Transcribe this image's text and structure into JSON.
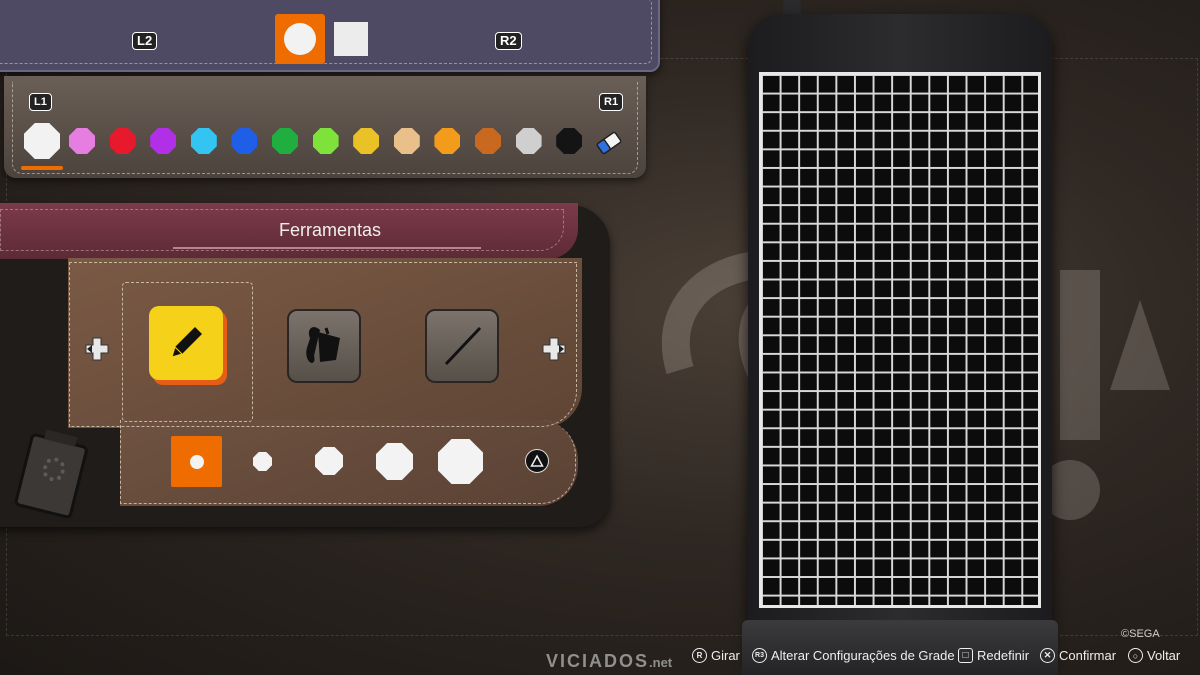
{
  "shape_bar": {
    "left_trigger": "L2",
    "right_trigger": "R2",
    "shapes": [
      {
        "name": "circle",
        "selected": true
      },
      {
        "name": "square",
        "selected": false
      }
    ],
    "accent_color": "#ef6c00"
  },
  "palette": {
    "left_bumper": "L1",
    "right_bumper": "R1",
    "selected_index": 0,
    "colors": [
      "#f2f2f2",
      "#e57ee0",
      "#e8192c",
      "#b12fe6",
      "#33c4f2",
      "#1f5fe8",
      "#1fae3f",
      "#7ee23a",
      "#eac126",
      "#e9c08a",
      "#f39c1c",
      "#c8691f",
      "#cfcfcf",
      "#141414"
    ],
    "eraser_icon": "eraser-icon"
  },
  "tools": {
    "title": "Ferramentas",
    "items": [
      {
        "name": "pencil",
        "icon": "pencil-icon",
        "selected": true
      },
      {
        "name": "bucket",
        "icon": "paint-bucket-icon",
        "selected": false
      },
      {
        "name": "line",
        "icon": "line-icon",
        "selected": false
      }
    ],
    "brush_sizes": [
      1,
      2,
      3,
      4,
      5
    ],
    "selected_size_index": 0,
    "triangle_glyph": "triangle-button-icon"
  },
  "canvas": {
    "columns": 15,
    "rows": 29
  },
  "footer": {
    "watermark_main": "VICIADOS",
    "watermark_suffix": ".net",
    "copyright": "©SEGA",
    "actions": [
      {
        "glyph": "R",
        "label": "Girar"
      },
      {
        "glyph": "R3",
        "label": "Alterar Configurações de Grade"
      },
      {
        "glyph": "□",
        "label": "Redefinir"
      },
      {
        "glyph": "✕",
        "label": "Confirmar"
      },
      {
        "glyph": "○",
        "label": "Voltar"
      }
    ]
  }
}
